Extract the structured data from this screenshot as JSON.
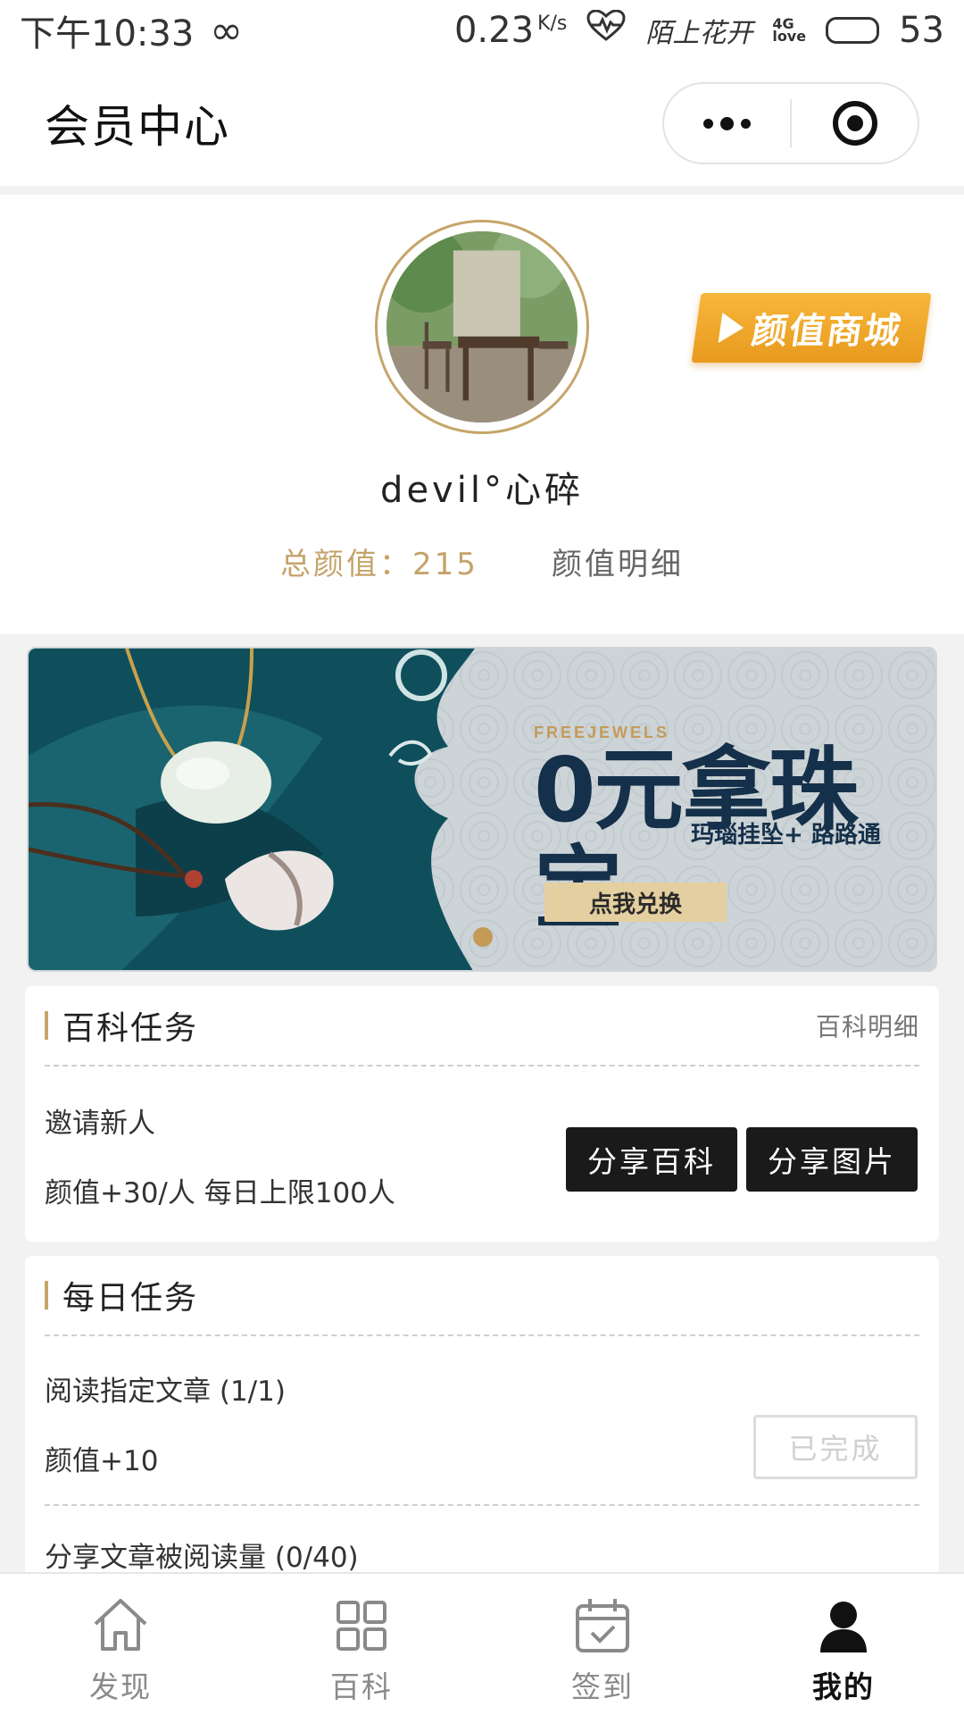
{
  "status_bar": {
    "time": "下午10:33",
    "net_rate": "0.23",
    "net_unit": "K/s",
    "carrier_text": "陌上花开",
    "network_type": "4G",
    "network_tag": "love",
    "battery": "53",
    "battery_level": 0.53
  },
  "nav": {
    "title": "会员中心",
    "more_icon": "more-dots-icon",
    "close_icon": "target-icon"
  },
  "profile": {
    "username": "devil°心碎",
    "total_score": "总颜值：215",
    "score_detail": "颜值明细",
    "mall_label": "颜值商城"
  },
  "banner": {
    "brand": "FREEJEWELS",
    "headline": "0元拿珠宝",
    "subline": "玛瑙挂坠+ 路路通",
    "cta": "点我兑换"
  },
  "wiki_task": {
    "title": "百科任务",
    "link": "百科明细",
    "task_name": "邀请新人",
    "task_reward": "颜值+30/人 每日上限100人",
    "btn_share_wiki": "分享百科",
    "btn_share_image": "分享图片"
  },
  "daily_task": {
    "title": "每日任务",
    "task1_name": "阅读指定文章 (1/1)",
    "task1_reward": "颜值+10",
    "task1_status": "已完成",
    "task2_name": "分享文章被阅读量 (0/40)"
  },
  "tabs": [
    {
      "label": "发现",
      "icon": "home-icon",
      "active": false
    },
    {
      "label": "百科",
      "icon": "grid-icon",
      "active": false
    },
    {
      "label": "签到",
      "icon": "calendar-check-icon",
      "active": false
    },
    {
      "label": "我的",
      "icon": "user-icon",
      "active": true
    }
  ],
  "colors": {
    "accent_gold": "#c6a56a",
    "mall_orange": "#f2a92b",
    "dark_button": "#1a1a1a"
  }
}
